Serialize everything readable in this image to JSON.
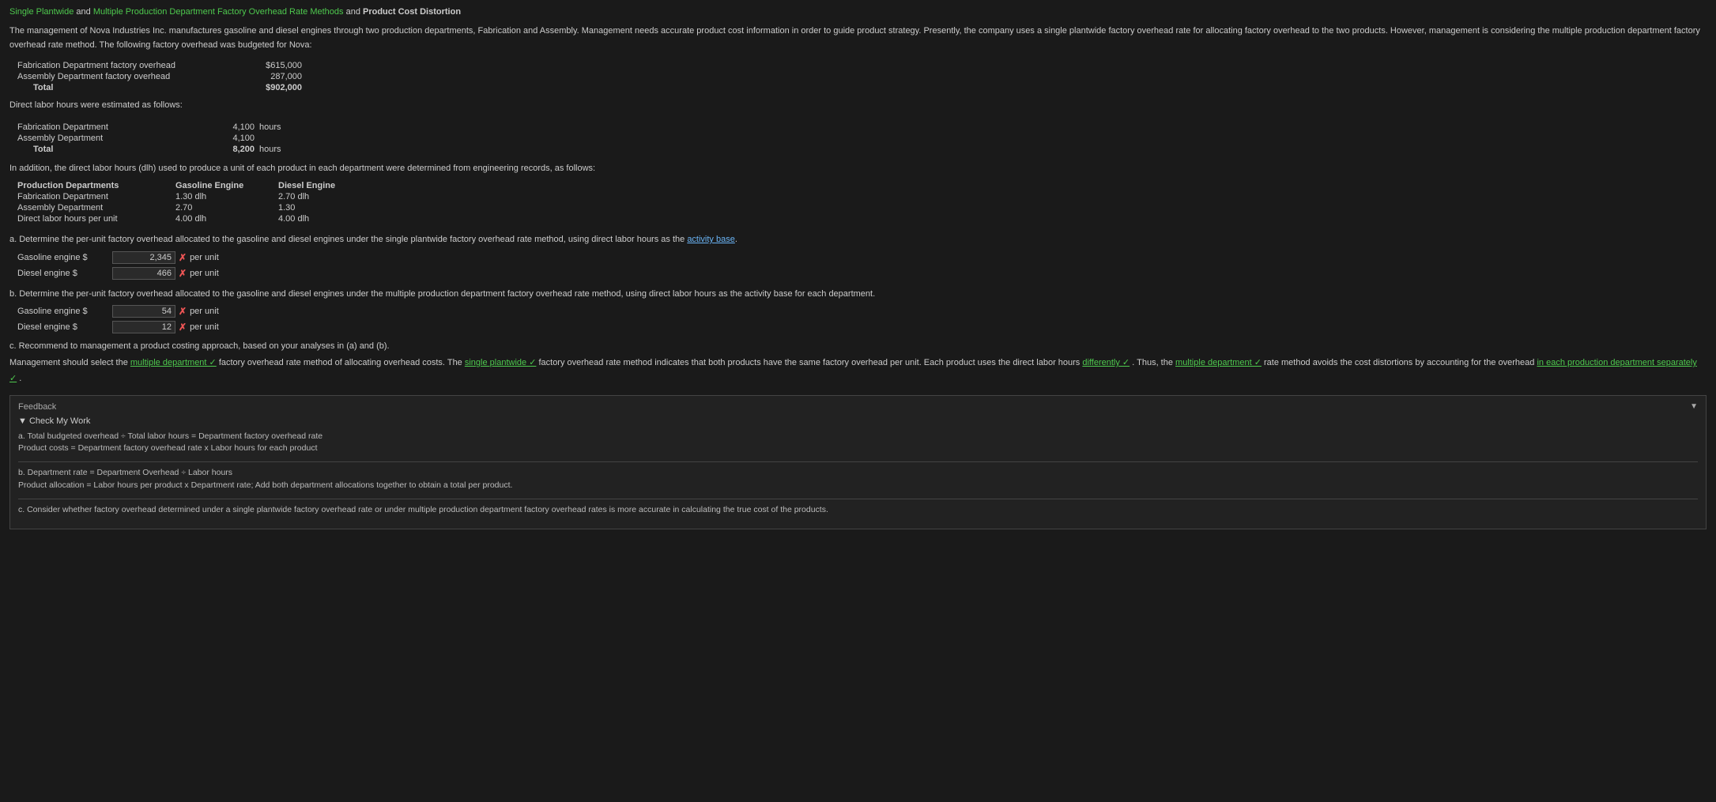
{
  "title": {
    "part1": "Single Plantwide",
    "and1": " and ",
    "part2": "Multiple Production Department Factory Overhead Rate Methods",
    "and2": " and ",
    "part3": "Product Cost Distortion"
  },
  "intro": "The management of Nova Industries Inc. manufactures gasoline and diesel engines through two production departments, Fabrication and Assembly. Management needs accurate product cost information in order to guide product strategy. Presently, the company uses a single plantwide factory overhead rate for allocating factory overhead to the two products. However, management is considering the multiple production department factory overhead rate method. The following factory overhead was budgeted for Nova:",
  "overhead": {
    "rows": [
      {
        "label": "Fabrication Department factory overhead",
        "value": "$615,000"
      },
      {
        "label": "Assembly Department factory overhead",
        "value": "287,000"
      }
    ],
    "total_label": "Total",
    "total_value": "$902,000"
  },
  "direct_labor_header": "Direct labor hours were estimated as follows:",
  "hours": {
    "rows": [
      {
        "label": "Fabrication Department",
        "value": "4,100",
        "unit": "hours"
      },
      {
        "label": "Assembly Department",
        "value": "4,100",
        "unit": ""
      }
    ],
    "total_label": "Total",
    "total_value": "8,200",
    "total_unit": "hours"
  },
  "additional_text": "In addition, the direct labor hours (dlh) used to produce a unit of each product in each department were determined from engineering records, as follows:",
  "dept_table": {
    "headers": [
      "Production Departments",
      "Gasoline Engine",
      "Diesel Engine"
    ],
    "rows": [
      {
        "dept": "Fabrication Department",
        "gasoline": "1.30  dlh",
        "diesel": "2.70  dlh"
      },
      {
        "dept": "Assembly Department",
        "gasoline": "2.70",
        "diesel": "1.30"
      },
      {
        "dept": "Direct labor hours per unit",
        "gasoline": "4.00  dlh",
        "diesel": "4.00  dlh"
      }
    ]
  },
  "question_a": {
    "label": "a.  Determine the per-unit factory overhead allocated to the gasoline and diesel engines under the single plantwide factory overhead rate method, using direct labor hours as the",
    "link_text": "activity base",
    "suffix": ".",
    "gasoline": {
      "label": "Gasoline engine  $",
      "value": "2,345",
      "mark": "✗",
      "per_unit": "per unit"
    },
    "diesel": {
      "label": "Diesel engine     $",
      "value": "466",
      "mark": "✗",
      "per_unit": "per unit"
    }
  },
  "question_b": {
    "label": "b.  Determine the per-unit factory overhead allocated to the gasoline and diesel engines under the multiple production department factory overhead rate method, using direct labor hours as the activity base for each department.",
    "gasoline": {
      "label": "Gasoline engine  $",
      "value": "54",
      "mark": "✗",
      "per_unit": "per unit"
    },
    "diesel": {
      "label": "Diesel engine     $",
      "value": "12",
      "mark": "✗",
      "per_unit": "per unit"
    }
  },
  "question_c": {
    "label": "c.  Recommend to management a product costing approach, based on your analyses in (a) and (b).",
    "paragraph": {
      "part1": "Management should select the",
      "link1": "multiple department ✓",
      "part2": "factory overhead rate method of allocating overhead costs. The",
      "link2": "single plantwide ✓",
      "part3": "factory overhead rate method indicates that both products have the same factory overhead per unit. Each product uses the direct labor hours",
      "link3": "differently ✓",
      "part4": ". Thus, the",
      "link4": "multiple department ✓",
      "part5": "rate method avoids the cost distortions by accounting for the overhead",
      "link5": "in each production department separately ✓",
      "part6": "."
    }
  },
  "feedback": {
    "title": "Feedback",
    "arrow": "▼",
    "check_my_work": "▼ Check My Work",
    "items": [
      {
        "letter": "a.",
        "lines": [
          "Total budgeted overhead ÷ Total labor hours = Department factory overhead rate",
          "Product costs = Department factory overhead rate x Labor hours for each product"
        ]
      },
      {
        "letter": "b.",
        "lines": [
          "Department rate = Department Overhead ÷ Labor hours",
          "Product allocation = Labor hours per product x Department rate; Add both department allocations together to obtain a total per product."
        ]
      },
      {
        "letter": "c.",
        "lines": [
          "Consider whether factory overhead determined under a single plantwide factory overhead rate or under multiple production department factory overhead rates is more accurate in calculating the true cost of the products."
        ]
      }
    ]
  }
}
